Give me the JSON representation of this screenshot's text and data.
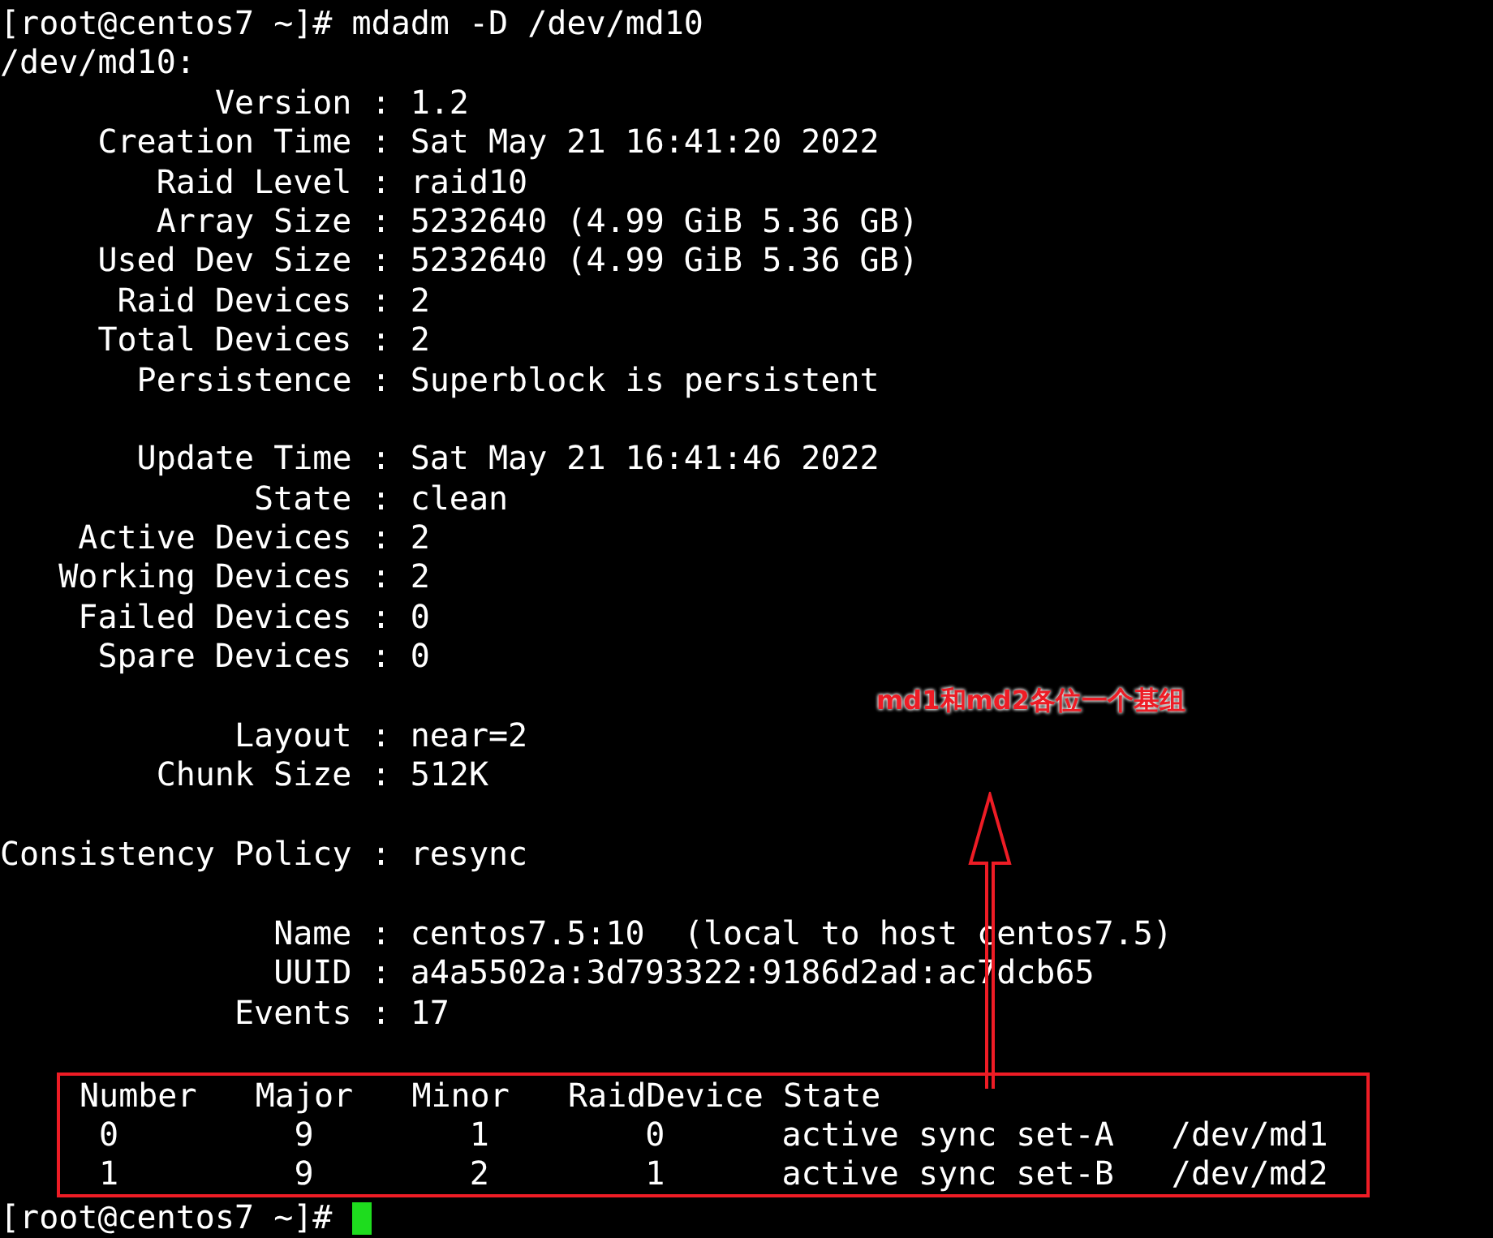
{
  "terminal": {
    "command_line": "[root@centos7 ~]# mdadm -D /dev/md10",
    "device_header": "/dev/md10:",
    "field_groups": [
      [
        {
          "label": "Version",
          "separator": ":",
          "value": "1.2"
        },
        {
          "label": "Creation Time",
          "separator": ":",
          "value": "Sat May 21 16:41:20 2022"
        },
        {
          "label": "Raid Level",
          "separator": ":",
          "value": "raid10"
        },
        {
          "label": "Array Size",
          "separator": ":",
          "value": "5232640 (4.99 GiB 5.36 GB)"
        },
        {
          "label": "Used Dev Size",
          "separator": ":",
          "value": "5232640 (4.99 GiB 5.36 GB)"
        },
        {
          "label": "Raid Devices",
          "separator": ":",
          "value": "2"
        },
        {
          "label": "Total Devices",
          "separator": ":",
          "value": "2"
        },
        {
          "label": "Persistence",
          "separator": ":",
          "value": "Superblock is persistent"
        }
      ],
      [
        {
          "label": "Update Time",
          "separator": ":",
          "value": "Sat May 21 16:41:46 2022"
        },
        {
          "label": "State",
          "separator": ":",
          "value": "clean"
        },
        {
          "label": "Active Devices",
          "separator": ":",
          "value": "2"
        },
        {
          "label": "Working Devices",
          "separator": ":",
          "value": "2"
        },
        {
          "label": "Failed Devices",
          "separator": ":",
          "value": "0"
        },
        {
          "label": "Spare Devices",
          "separator": ":",
          "value": "0"
        }
      ],
      [
        {
          "label": "Layout",
          "separator": ":",
          "value": "near=2"
        },
        {
          "label": "Chunk Size",
          "separator": ":",
          "value": "512K"
        }
      ],
      [
        {
          "label": "Consistency Policy",
          "separator": ":",
          "value": "resync"
        }
      ],
      [
        {
          "label": "Name",
          "separator": ":",
          "value": "centos7.5:10  (local to host centos7.5)"
        },
        {
          "label": "UUID",
          "separator": ":",
          "value": "a4a5502a:3d793322:9186d2ad:ac7dcb65"
        },
        {
          "label": "Events",
          "separator": ":",
          "value": "17"
        }
      ]
    ],
    "device_table": {
      "columns": [
        "Number",
        "Major",
        "Minor",
        "RaidDevice",
        "State"
      ],
      "rows": [
        [
          "0",
          "9",
          "1",
          "0",
          "active sync set-A",
          "/dev/md1"
        ],
        [
          "1",
          "9",
          "2",
          "1",
          "active sync set-B",
          "/dev/md2"
        ]
      ]
    },
    "prompt": "[root@centos7 ~]#"
  },
  "annotation": {
    "text": "md1和md2各位一个基组"
  }
}
